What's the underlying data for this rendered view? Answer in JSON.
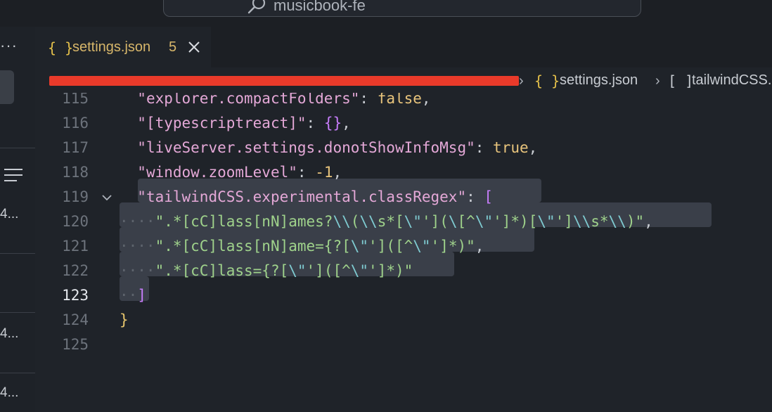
{
  "window": {
    "title": "musicbook-fe"
  },
  "sidebar": {
    "more_label": "···",
    "items": [
      "4...",
      "4...",
      "4..."
    ]
  },
  "tab": {
    "icon": "{ }",
    "file_name": "settings.json",
    "problem_count": "5"
  },
  "breadcrumb": {
    "file_icon": "{ }",
    "file": "settings.json",
    "key_icon": "[ ]",
    "key": "tailwindCSS.experimental.classRegex"
  },
  "editor": {
    "line_numbers": [
      "115",
      "116",
      "117",
      "118",
      "119",
      "120",
      "121",
      "122",
      "123",
      "124",
      "125"
    ],
    "current_line": "123",
    "lines": [
      "  \"explorer.compactFolders\": false,",
      "  \"[typescriptreact]\": {},",
      "  \"liveServer.settings.donotShowInfoMsg\": true,",
      "  \"window.zoomLevel\": -1,",
      "  \"tailwindCSS.experimental.classRegex\": [",
      "    \".*[cC]lass[nN]ames?\\\\(\\\\s*[\\\"'](\\[^\\\"']*)[\\\"']\\\\s*\\\\)\",",
      "    \".*[cC]lass[nN]ame={?[\\\"']([^\\\"']*)\",",
      "    \".*[cC]lass={?[\\\"']([^\\\"']*)\"",
      "  ]",
      "}",
      ""
    ]
  },
  "colors": {
    "background": "#1f2329",
    "string": "#9fd28b",
    "key_string": "#e4a8d7",
    "constant": "#e8c47c",
    "escape": "#7fcbd1",
    "bracket_purple": "#c77dfb",
    "warning_yellow": "#d7b66a",
    "redaction": "#e93a2a"
  },
  "icons": [
    "search-icon",
    "list-icon",
    "close-icon",
    "chevron-right-icon",
    "chevron-down-icon"
  ]
}
